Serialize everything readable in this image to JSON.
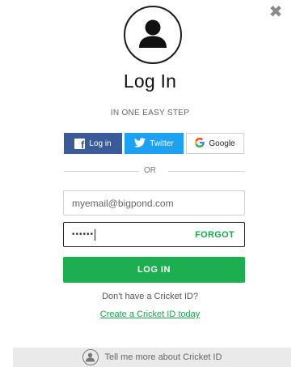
{
  "title": "Log In",
  "subtitle": "IN ONE EASY STEP",
  "social": {
    "facebook_label": "Log in",
    "twitter_label": "Twitter",
    "google_label": "Google"
  },
  "divider_text": "OR",
  "email_field": {
    "value": "myemail@bigpond.com",
    "placeholder": "myemail@bigpond.com"
  },
  "password_field": {
    "masked_value": "••••••",
    "forgot_label": "FORGOT"
  },
  "login_button_label": "LOG IN",
  "no_account_text": "Don't have a Cricket ID?",
  "create_link_text": "Create a Cricket ID today",
  "footer_text": "Tell me more about Cricket ID",
  "icons": {
    "close": "close-icon",
    "avatar": "user-icon",
    "facebook": "facebook-icon",
    "twitter": "twitter-icon",
    "google": "google-icon",
    "footer": "user-circle-icon"
  },
  "colors": {
    "facebook": "#3b5b98",
    "twitter": "#1da1f2",
    "accent_green": "#1cae4f",
    "link_green": "#19a84b",
    "footer_bg": "#eaeaea"
  }
}
